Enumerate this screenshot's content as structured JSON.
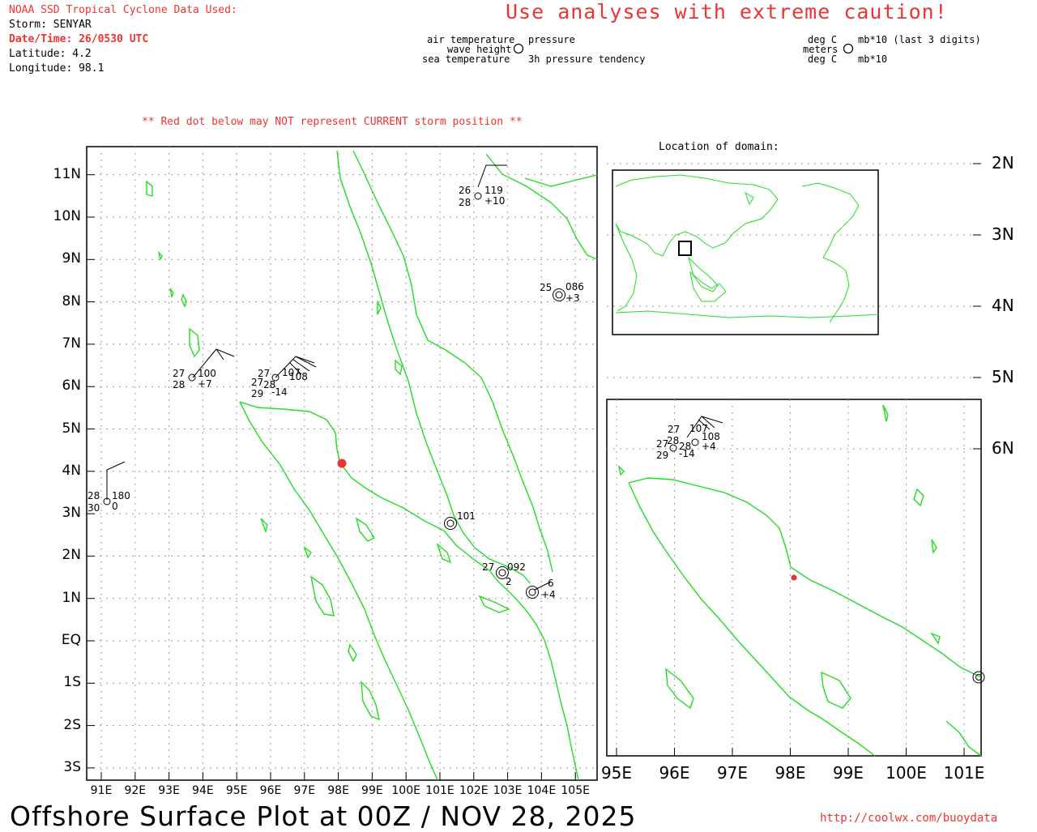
{
  "header": {
    "source": "NOAA SSD Tropical Cyclone Data Used:",
    "storm": "Storm: SENYAR",
    "datetime": "Date/Time: 26/0530 UTC",
    "latitude": "Latitude: 4.2",
    "longitude": "Longitude: 98.1",
    "caution": "Use analyses with extreme caution!",
    "red_dot_note": "** Red dot below may NOT represent CURRENT storm position **"
  },
  "legend": {
    "air_temperature": "air temperature",
    "wave_height": "wave height",
    "sea_temperature": "sea temperature",
    "pressure": "pressure",
    "pressure_tendency": "3h pressure tendency",
    "unit_air": "deg C",
    "unit_wave": "meters",
    "unit_sea": "deg C",
    "unit_pressure": "mb*10 (last 3 digits)",
    "unit_tendency": "mb*10"
  },
  "location_title": "Location of domain:",
  "footer": {
    "title": "Offshore Surface Plot at 00Z / NOV 28, 2025",
    "url": "http://coolwx.com/buoydata"
  },
  "colors": {
    "land": "#22dd22",
    "accent": "#ee3333",
    "grid": "#999999"
  },
  "main_map": {
    "lat_labels": [
      "11N",
      "10N",
      "9N",
      "8N",
      "7N",
      "6N",
      "5N",
      "4N",
      "3N",
      "2N",
      "1N",
      "EQ",
      "1S",
      "2S",
      "3S"
    ],
    "lon_labels": [
      "91E",
      "92E",
      "93E",
      "94E",
      "95E",
      "96E",
      "97E",
      "98E",
      "99E",
      "100E",
      "101E",
      "102E",
      "103E",
      "104E",
      "105E"
    ],
    "storm_position": {
      "lat": 4.2,
      "lon": 98.1
    },
    "stations": [
      {
        "id": "s1",
        "lat": 10.5,
        "lon": 102.1,
        "air": "26",
        "sea": "28",
        "pressure": "119",
        "tendency": "+10"
      },
      {
        "id": "s2",
        "lat": 8.2,
        "lon": 104.5,
        "air": "25",
        "pressure": "086",
        "tendency": "+3"
      },
      {
        "id": "s3",
        "lat": 6.2,
        "lon": 93.7,
        "air": "27",
        "sea": "28",
        "pressure": "100",
        "tendency": "+7"
      },
      {
        "id": "s4",
        "lat": 6.3,
        "lon": 96.1,
        "air": "27",
        "sea": "27",
        "pressure": "107",
        "tendency": ""
      },
      {
        "id": "s5",
        "lat": 6.0,
        "lon": 96.0,
        "air": "28",
        "sea": "29",
        "pressure": "108",
        "tendency": "-14"
      },
      {
        "id": "s6",
        "lat": 3.3,
        "lon": 91.2,
        "air": "28",
        "sea": "30",
        "pressure": "180",
        "tendency": "0"
      },
      {
        "id": "s7",
        "lat": 2.8,
        "lon": 101.3,
        "pressure": "101"
      },
      {
        "id": "s8",
        "lat": 1.6,
        "lon": 102.8,
        "air": "27",
        "pressure": "092"
      },
      {
        "id": "s9",
        "lat": 1.2,
        "lon": 103.6,
        "air": "2",
        "pressure": "6",
        "tendency": "+4"
      }
    ]
  },
  "inset_map": {
    "lat_labels": [
      "6N",
      "5N",
      "4N",
      "3N",
      "2N"
    ],
    "lon_labels": [
      "95E",
      "96E",
      "97E",
      "98E",
      "99E",
      "100E",
      "101E"
    ],
    "storm_position": {
      "lat": 4.2,
      "lon": 98.1
    },
    "stations": [
      {
        "id": "i1",
        "air": "27",
        "sea": "28",
        "pressure": "107",
        "tendency": ""
      },
      {
        "id": "i2",
        "air": "27",
        "sea": "29",
        "pressure": "108",
        "tendency": "+4"
      },
      {
        "id": "i3",
        "air": "28",
        "sea": "",
        "pressure": "",
        "tendency": "-14"
      }
    ]
  }
}
